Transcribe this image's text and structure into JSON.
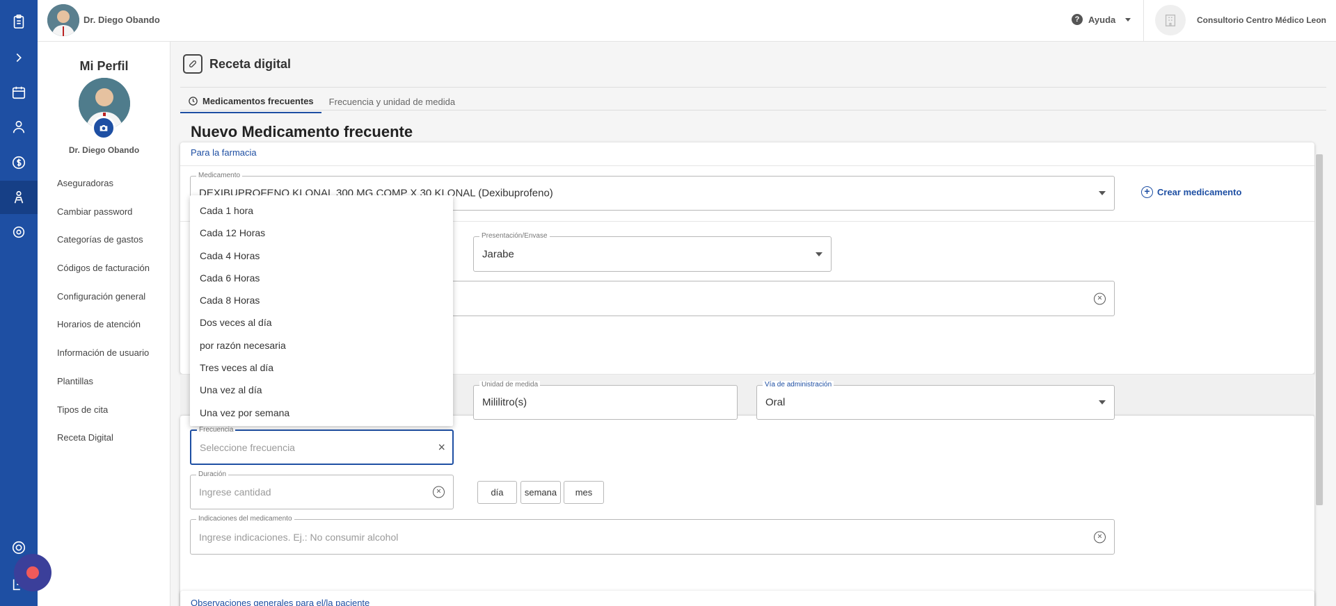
{
  "topbar": {
    "user_name": "Dr. Diego Obando",
    "help_label": "Ayuda",
    "clinic_name": "Consultorio Centro Médico Leon"
  },
  "sidebar": {
    "title": "Mi Perfil",
    "user_name": "Dr. Diego Obando",
    "items": [
      {
        "label": "Aseguradoras"
      },
      {
        "label": "Cambiar password"
      },
      {
        "label": "Categorías de gastos"
      },
      {
        "label": "Códigos de facturación"
      },
      {
        "label": "Configuración general"
      },
      {
        "label": "Horarios de atención"
      },
      {
        "label": "Información de usuario"
      },
      {
        "label": "Plantillas"
      },
      {
        "label": "Tipos de cita"
      },
      {
        "label": "Receta Digital"
      }
    ]
  },
  "rail": {
    "icons": [
      "clipboard-icon",
      "chevron-right-icon",
      "calendar-icon",
      "patients-icon",
      "dollar-icon",
      "doctor-icon",
      "gear-icon",
      "support-icon",
      "logout-icon"
    ]
  },
  "page": {
    "title": "Receta digital",
    "tabs": [
      {
        "label": "Medicamentos frecuentes",
        "active": true
      },
      {
        "label": "Frecuencia y unidad de medida",
        "active": false
      }
    ],
    "section_title": "Nuevo Medicamento frecuente",
    "pharmacy_label": "Para la farmacia",
    "patient_observations_label": "Observaciones generales para el/la paciente"
  },
  "form": {
    "medicamento": {
      "label": "Medicamento",
      "value": "DEXIBUPROFENO KLONAL 300 MG COMP X 30 KLONAL (Dexibuprofeno)"
    },
    "create_med_label": "Crear medicamento",
    "presentacion": {
      "label": "Presentación/Envase",
      "value": "Jarabe"
    },
    "unidad": {
      "label": "Unidad de medida",
      "value": "Mililitro(s)"
    },
    "via": {
      "label": "Vía de administración",
      "value": "Oral"
    },
    "frecuencia": {
      "label": "Frecuencia",
      "placeholder": "Seleccione frecuencia"
    },
    "duracion": {
      "label": "Duración",
      "placeholder": "Ingrese cantidad"
    },
    "duration_units": [
      "día",
      "semana",
      "mes"
    ],
    "indicaciones": {
      "label": "Indicaciones del medicamento",
      "placeholder": "Ingrese indicaciones. Ej.: No consumir alcohol"
    }
  },
  "frequency_options": [
    "Cada 1 hora",
    "Cada 12 Horas",
    "Cada 4 Horas",
    "Cada 6 Horas",
    "Cada 8 Horas",
    "Dos veces al día",
    "por razón necesaria",
    "Tres veces al día",
    "Una vez al día",
    "Una vez por semana"
  ],
  "colors": {
    "primary": "#1e4fa3",
    "notification": "#f05a5a"
  }
}
